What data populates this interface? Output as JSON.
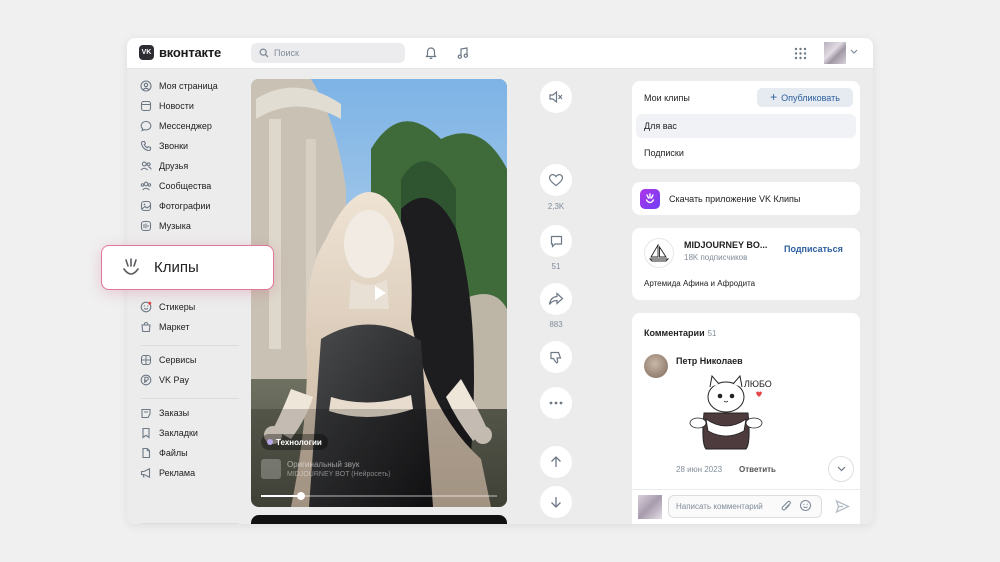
{
  "header": {
    "logo_badge": "VK",
    "logo_text": "вконтакте",
    "search_placeholder": "Поиск"
  },
  "menu": {
    "items": [
      {
        "label": "Моя страница",
        "icon": "user-circle-icon"
      },
      {
        "label": "Новости",
        "icon": "newspaper-icon"
      },
      {
        "label": "Мессенджер",
        "icon": "message-icon"
      },
      {
        "label": "Звонки",
        "icon": "phone-icon"
      },
      {
        "label": "Друзья",
        "icon": "friends-icon"
      },
      {
        "label": "Сообщества",
        "icon": "communities-icon"
      },
      {
        "label": "Фотографии",
        "icon": "photo-icon"
      },
      {
        "label": "Музыка",
        "icon": "music-icon"
      },
      {
        "label": "Стикеры",
        "icon": "sticker-icon"
      },
      {
        "label": "Маркет",
        "icon": "market-icon"
      },
      {
        "label": "Сервисы",
        "icon": "services-icon"
      },
      {
        "label": "VK Pay",
        "icon": "vkpay-icon"
      },
      {
        "label": "Заказы",
        "icon": "orders-icon"
      },
      {
        "label": "Закладки",
        "icon": "bookmark-icon"
      },
      {
        "label": "Файлы",
        "icon": "files-icon"
      },
      {
        "label": "Реклама",
        "icon": "megaphone-icon"
      }
    ]
  },
  "callout": {
    "label": "Клипы",
    "icon": "clips-icon"
  },
  "video": {
    "tag": "Технологии",
    "audio_title": "Оригинальный звук",
    "audio_author": "MIDJOURNEY BOT (Нейросеть)",
    "progress": 0.17
  },
  "actions": {
    "likes": "2,3K",
    "comments": "51",
    "shares": "883"
  },
  "clips_panel": {
    "title": "Мои клипы",
    "publish_label": "Опубликовать",
    "for_you": "Для вас",
    "subscriptions": "Подписки"
  },
  "download": {
    "label": "Скачать приложение VK Клипы"
  },
  "author": {
    "name": "MIDJOURNEY BO...",
    "subscribers": "18K подписчиков",
    "subscribe_label": "Подписаться",
    "description": "Артемида Афина и Афродита"
  },
  "comments": {
    "title": "Комментарии",
    "count": "51",
    "author": "Петр Николаев",
    "sticker_text": "ЛЮБО",
    "date": "28 июн 2023",
    "reply_label": "Ответить",
    "input_placeholder": "Написать комментарий"
  },
  "colors": {
    "accent": "#2c5ea0",
    "callout_border": "#e07896",
    "clips_gradient_start": "#ad35e8",
    "clips_gradient_end": "#6f3ff5"
  }
}
